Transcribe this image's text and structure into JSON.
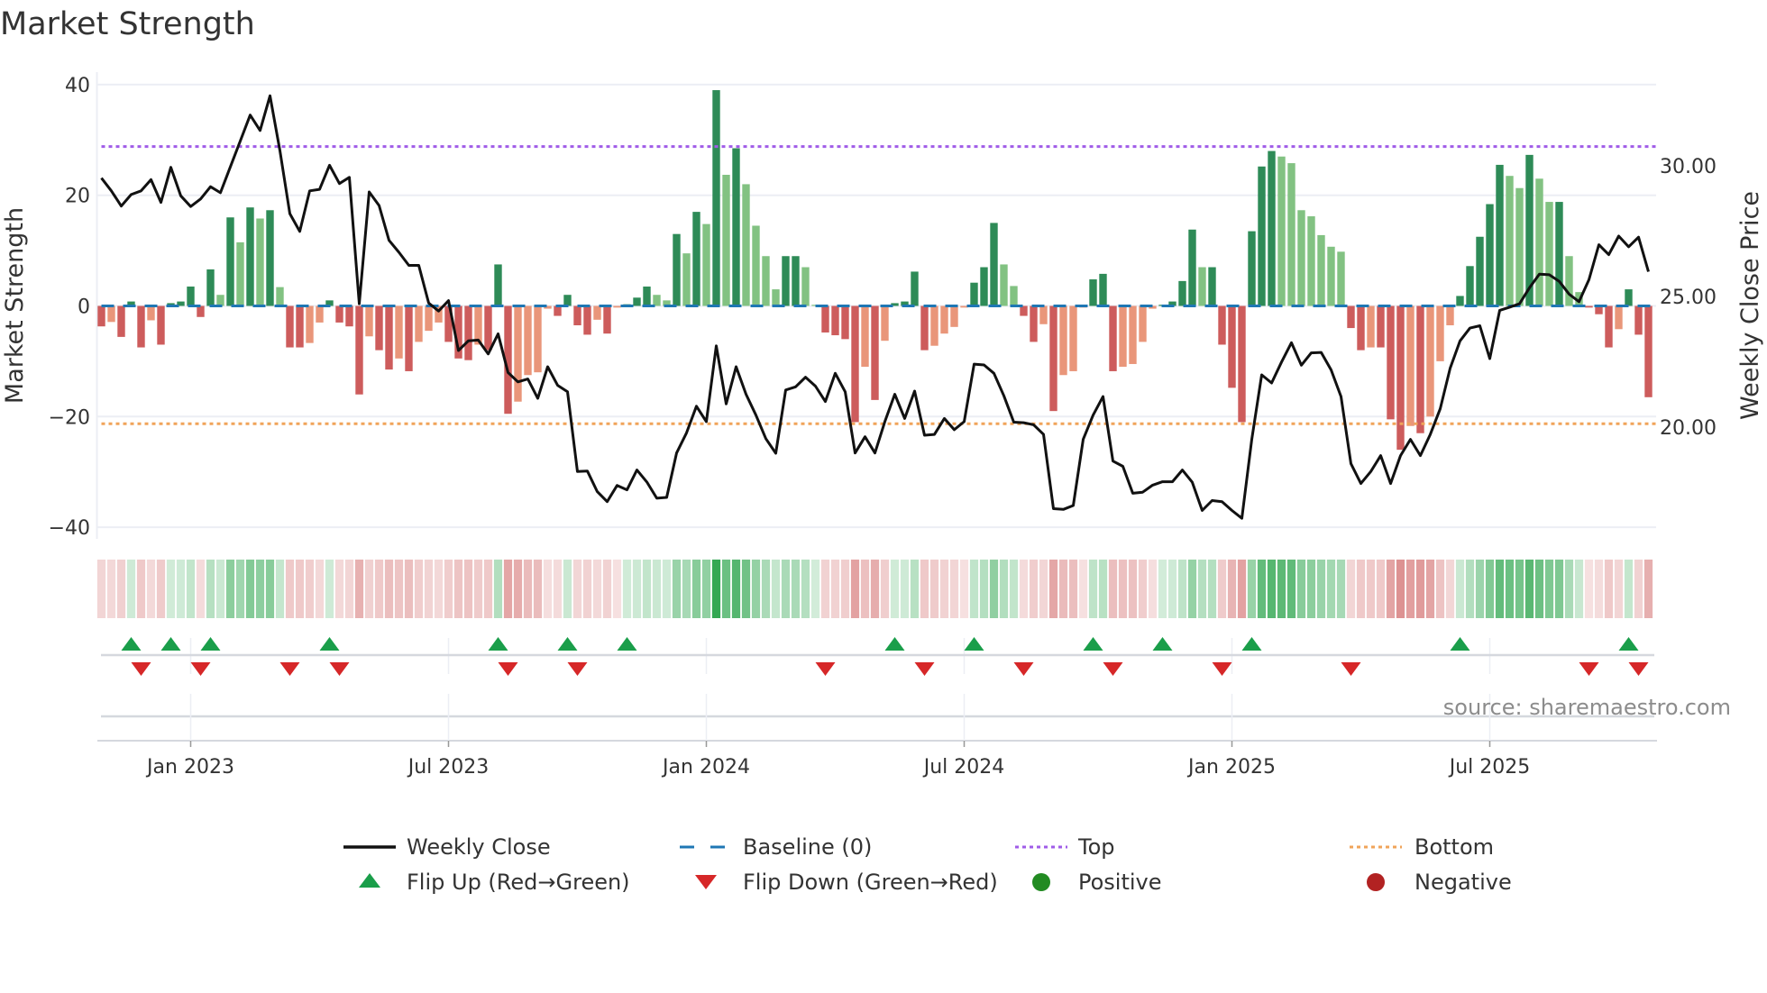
{
  "chart_data": {
    "type": "bar",
    "title": "Market Strength",
    "ylabel": "Market Strength",
    "y2label": "Weekly Close Price",
    "ylim": [
      -42,
      42
    ],
    "yticks": [
      "40",
      "20",
      "0",
      "−20",
      "−40"
    ],
    "ytick_values": [
      40,
      20,
      0,
      -20,
      -40
    ],
    "y2ticks": [
      "30.00",
      "25.00",
      "20.00"
    ],
    "y2tick_values": [
      30,
      25,
      20
    ],
    "xticks": [
      "Jan 2023",
      "Jul 2023",
      "Jan 2024",
      "Jul 2024",
      "Jan 2025",
      "Jul 2025"
    ],
    "xtick_weeks": [
      9,
      35,
      61,
      87,
      114,
      140
    ],
    "frequency": "weekly",
    "top_level": 28.8,
    "bottom_level": -21.3,
    "baseline": 0,
    "strength": [
      -3.7,
      -2.9,
      -5.6,
      0.8,
      -7.5,
      -2.6,
      -7,
      0.5,
      0.8,
      3.5,
      -2,
      6.6,
      2,
      16,
      11.5,
      17.8,
      15.8,
      17.3,
      3.4,
      -7.5,
      -7.5,
      -6.7,
      -3,
      1,
      -3,
      -3.7,
      -16,
      -5.5,
      -8,
      -11.5,
      -9.5,
      -11.8,
      -6.5,
      -4.5,
      -3,
      -6.5,
      -9.5,
      -9.8,
      -7,
      -8,
      7.5,
      -19.5,
      -17.3,
      -12.5,
      -12,
      -0.5,
      -1.8,
      2,
      -3.5,
      -5.2,
      -2.5,
      -5,
      -0.3,
      0.3,
      1.5,
      3.5,
      2,
      1,
      13,
      9.5,
      17,
      14.8,
      39,
      23.7,
      28.5,
      22,
      14.5,
      9,
      3,
      9,
      9,
      7,
      0.2,
      -4.8,
      -5.3,
      -6,
      -21,
      -11,
      -17,
      -6.3,
      0.5,
      0.8,
      6.2,
      -8,
      -7.2,
      -5,
      -3.8,
      -0.3,
      4.2,
      7,
      15,
      7.5,
      3.6,
      -1.8,
      -6.5,
      -3.3,
      -19,
      -12.5,
      -11.8,
      -0.3,
      4.8,
      5.8,
      -11.8,
      -11,
      -10.5,
      -6.5,
      -0.5,
      0.2,
      0.8,
      4.5,
      13.8,
      7,
      7,
      -7,
      -14.8,
      -21,
      13.5,
      25.2,
      28,
      27,
      25.8,
      17.3,
      16.2,
      12.8,
      10.7,
      9.8,
      -4,
      -8,
      -7.5,
      -7.5,
      -20.5,
      -26,
      -21.7,
      -23,
      -20,
      -10,
      -3.5,
      1.8,
      7.2,
      12.5,
      18.4,
      25.5,
      23.5,
      21.3,
      27.3,
      23,
      18.8,
      18.8,
      9,
      2.5,
      -0.3,
      -1.5,
      -7.5,
      -4.2,
      3,
      -5.2,
      -16.5
    ],
    "weekly_close": [
      29.53,
      29.04,
      28.46,
      28.9,
      29.04,
      29.47,
      28.6,
      29.94,
      28.85,
      28.44,
      28.73,
      29.2,
      28.97,
      29.96,
      30.95,
      31.94,
      31.35,
      32.68,
      30.58,
      28.17,
      27.49,
      29.04,
      29.1,
      30.02,
      29.32,
      29.56,
      24.72,
      29.0,
      28.48,
      27.15,
      26.69,
      26.19,
      26.19,
      24.75,
      24.44,
      24.84,
      22.93,
      23.3,
      23.33,
      22.8,
      23.57,
      22.09,
      21.73,
      21.84,
      21.1,
      22.31,
      21.6,
      21.35,
      18.3,
      18.32,
      17.53,
      17.15,
      17.77,
      17.6,
      18.36,
      17.9,
      17.28,
      17.31,
      19.01,
      19.78,
      20.8,
      20.21,
      23.11,
      20.89,
      22.31,
      21.26,
      20.46,
      19.56,
      19.0,
      21.42,
      21.54,
      21.91,
      21.57,
      20.98,
      22.06,
      21.35,
      19.01,
      19.63,
      19.01,
      20.21,
      21.26,
      20.33,
      21.38,
      19.69,
      19.72,
      20.33,
      19.9,
      20.21,
      22.41,
      22.38,
      22.06,
      21.2,
      20.19,
      20.17,
      20.09,
      19.72,
      16.88,
      16.85,
      17.0,
      19.53,
      20.46,
      21.17,
      18.7,
      18.5,
      17.47,
      17.51,
      17.78,
      17.91,
      17.91,
      18.36,
      17.89,
      16.81,
      17.19,
      17.15,
      16.81,
      16.51,
      19.53,
      22.0,
      21.69,
      22.49,
      23.23,
      22.37,
      22.84,
      22.86,
      22.19,
      21.17,
      18.6,
      17.84,
      18.3,
      18.91,
      17.84,
      18.91,
      19.53,
      18.91,
      19.72,
      20.7,
      22.25,
      23.3,
      23.79,
      23.88,
      22.62,
      24.47,
      24.59,
      24.72,
      25.33,
      25.85,
      25.83,
      25.58,
      25.09,
      24.8,
      25.64,
      26.98,
      26.6,
      27.31,
      26.9,
      27.27,
      25.95
    ],
    "flip_up_weeks": [
      3,
      7,
      11,
      23,
      40,
      47,
      53,
      80,
      88,
      100,
      107,
      116,
      137,
      154
    ],
    "flip_down_weeks": [
      4,
      10,
      19,
      24,
      41,
      48,
      73,
      83,
      93,
      102,
      113,
      126,
      150,
      155
    ],
    "legend": [
      {
        "label": "Weekly Close",
        "kind": "line"
      },
      {
        "label": "Baseline (0)",
        "kind": "dash"
      },
      {
        "label": "Top",
        "kind": "dot-top"
      },
      {
        "label": "Bottom",
        "kind": "dot-bottom"
      },
      {
        "label": "Flip Up (Red→Green)",
        "kind": "tri-up"
      },
      {
        "label": "Flip Down (Green→Red)",
        "kind": "tri-down"
      },
      {
        "label": "Positive",
        "kind": "circle-pos"
      },
      {
        "label": "Negative",
        "kind": "circle-neg"
      }
    ],
    "legend_placement": "bottom",
    "source": "source: sharemaestro.com"
  },
  "colors": {
    "pos_strong": "#2e8b57",
    "pos_weak": "#82c282",
    "neg_strong": "#cd5c5c",
    "neg_weak": "#e9967a",
    "baseline": "#1f77b4",
    "top": "#a05ce8",
    "bottom": "#f0a45a",
    "flip_up": "#1a9e4a",
    "flip_down": "#d62728",
    "positive": "#228b22",
    "negative": "#b22222",
    "price": "#111111"
  }
}
